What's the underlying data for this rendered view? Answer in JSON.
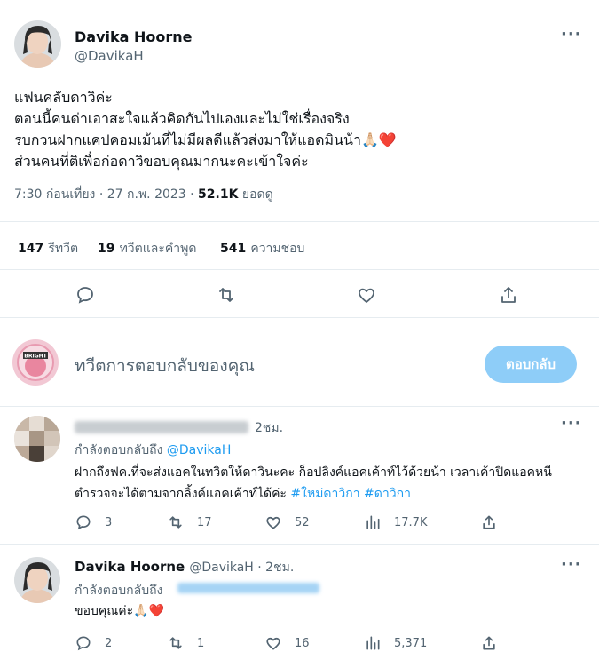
{
  "main_tweet": {
    "name": "Davika Hoorne",
    "handle": "@DavikaH",
    "lines": [
      "แฟนคลับดาวิค่ะ",
      "ตอนนี้คนด่าเอาสะใจแล้วคิดกันไปเองและไม่ใช่เรื่องจริง",
      "รบกวนฝากแคปคอมเม้นที่ไม่มีผลดีแล้วส่งมาให้แอดมินน้า🙏🏻❤️",
      "ส่วนคนที่ติเพื่อก่อดาวิขอบคุณมากนะคะเข้าใจค่ะ"
    ],
    "timestamp": "7:30 ก่อนเที่ยง · 27 ก.พ. 2023 · ",
    "views_count": "52.1K",
    "views_label": " ยอดดู",
    "stats": {
      "retweets_count": "147",
      "retweets_label": "รีทวีต",
      "quotes_count": "19",
      "quotes_label": "ทวีตและคำพูด",
      "likes_count": "541",
      "likes_label": "ความชอบ"
    },
    "more": "···"
  },
  "compose": {
    "placeholder": "ทวีตการตอบกลับของคุณ",
    "button_label": "ตอบกลับ",
    "avatar_text": "BRIGHT"
  },
  "reply1": {
    "time": "2ชม.",
    "replying_prefix": "กำลังตอบกลับถึง ",
    "replying_handle": "@DavikaH",
    "text_plain": "ฝากถึงฟค.ที่จะส่งแอคในทวิตให้ดาวินะคะ ก็อปลิงค์แอคเค้าท์ไว้ด้วยน้า เวลาเค้าปิดแอคหนี ตำรวจจะได้ตามจากลิ้งค์แอคเค้าท์ได้ค่ะ ",
    "hashtag1": "#ใหม่ดาวิกา",
    "hashtag2": "#ดาวิกา",
    "counts": {
      "replies": "3",
      "retweets": "17",
      "likes": "52",
      "views": "17.7K"
    },
    "more": "···"
  },
  "reply2": {
    "name": "Davika Hoorne",
    "handle_time": "@DavikaH · 2ชม.",
    "replying_prefix": "กำลังตอบกลับถึง",
    "text": "ขอบคุณค่ะ🙏🏻❤️",
    "counts": {
      "replies": "2",
      "retweets": "1",
      "likes": "16",
      "views": "5,371"
    },
    "more": "···"
  }
}
